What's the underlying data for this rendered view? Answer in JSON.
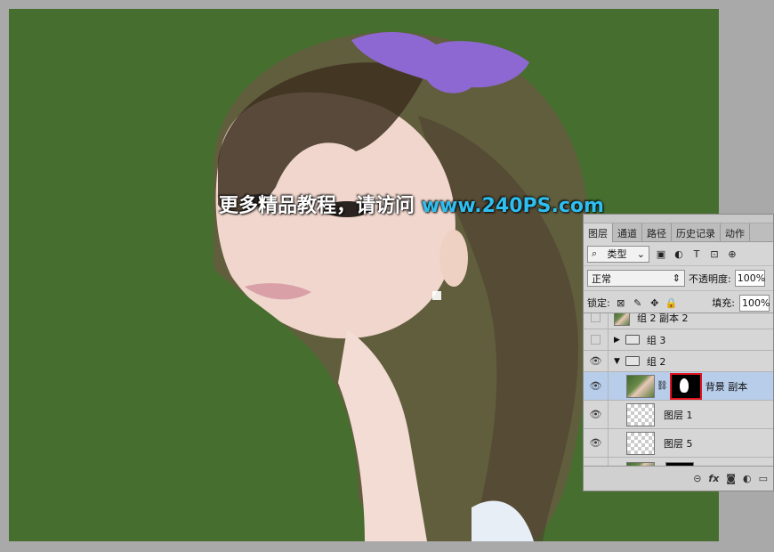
{
  "image": {
    "watermark_text": "更多精品教程，请访问",
    "watermark_url": "www.240PS.com"
  },
  "layers_panel": {
    "tabs": [
      "图层",
      "通道",
      "路径",
      "历史记录",
      "动作"
    ],
    "filter": {
      "label": "类型",
      "arrow": "⌄",
      "search_glyph": "⌕"
    },
    "filter_icons": [
      "image-filter-icon",
      "adjustment-filter-icon",
      "type-filter-icon",
      "shape-filter-icon",
      "smart-object-filter-icon"
    ],
    "filter_icon_glyphs": [
      "▣",
      "◐",
      "T",
      "⊡",
      "⊕"
    ],
    "blend_mode": "正常",
    "opacity_label": "不透明度:",
    "opacity_value": "100%",
    "lock_label": "锁定:",
    "lock_glyphs": [
      "⊠",
      "✎",
      "✥",
      "🔒"
    ],
    "fill_label": "填充:",
    "fill_value": "100%",
    "layers": [
      {
        "name": "组 2 副本 2",
        "visible": false
      },
      {
        "name": "组 3",
        "visible": false
      },
      {
        "name": "组 2",
        "visible": true
      },
      {
        "name": "背景 副本",
        "visible": true,
        "selected": true
      },
      {
        "name": "图层 1",
        "visible": true
      },
      {
        "name": "图层 5",
        "visible": true
      }
    ],
    "eye_glyph": "👁",
    "bottom_icons": [
      "⊝",
      "fx",
      "◙",
      "◐",
      "▭"
    ]
  }
}
